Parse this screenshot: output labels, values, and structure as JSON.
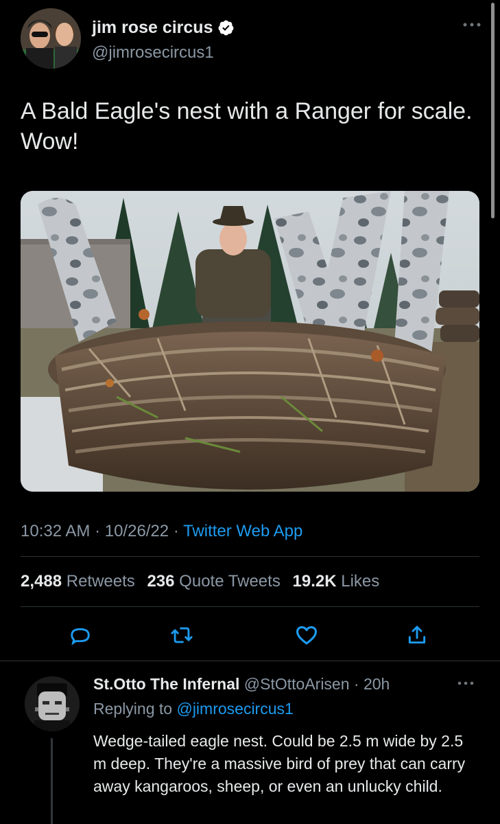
{
  "tweet": {
    "author_name": "jim rose circus",
    "author_handle": "@jimrosecircus1",
    "text": "A Bald Eagle's nest with a Ranger for scale. Wow!",
    "time": "10:32 AM",
    "date": "10/26/22",
    "separator": " · ",
    "source": "Twitter Web App"
  },
  "stats": {
    "retweets_count": "2,488",
    "retweets_label": "Retweets",
    "quotes_count": "236",
    "quotes_label": "Quote Tweets",
    "likes_count": "19.2K",
    "likes_label": "Likes"
  },
  "reply": {
    "author_name": "St.Otto The Infernal",
    "author_handle": "@StOttoArisen",
    "separator": " · ",
    "age": "20h",
    "replying_prefix": "Replying to ",
    "replying_to": "@jimrosecircus1",
    "text": "Wedge-tailed eagle nest. Could be 2.5 m wide by 2.5 m deep. They're a massive bird of prey that can carry away kangaroos, sheep, or even an unlucky child."
  },
  "icons": {
    "verified": "verified-badge-icon",
    "more": "more-options-icon",
    "reply": "reply-icon",
    "retweet": "retweet-icon",
    "like": "like-icon",
    "share": "share-icon"
  },
  "colors": {
    "background": "#000000",
    "text": "#e7e9ea",
    "muted": "#8b98a5",
    "accent": "#1d9bf0",
    "divider": "#2f3336"
  }
}
